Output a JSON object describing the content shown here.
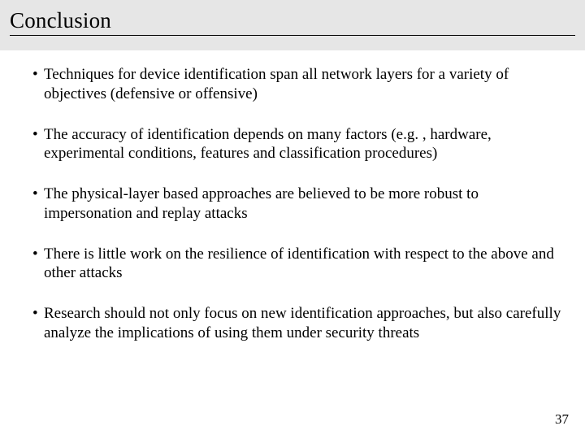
{
  "title": "Conclusion",
  "bullets": [
    "Techniques for device identification span all network layers for a variety of objectives (defensive or offensive)",
    "The accuracy of identification depends on many factors (e.g. , hardware, experimental conditions, features and classification procedures)",
    "The physical-layer based approaches are believed to be more robust to impersonation and replay attacks",
    "There is little work on the resilience of identification with respect to the above and other attacks",
    "Research should not only focus on new identification approaches, but also carefully analyze the implications of using them under security threats"
  ],
  "page_number": "37"
}
